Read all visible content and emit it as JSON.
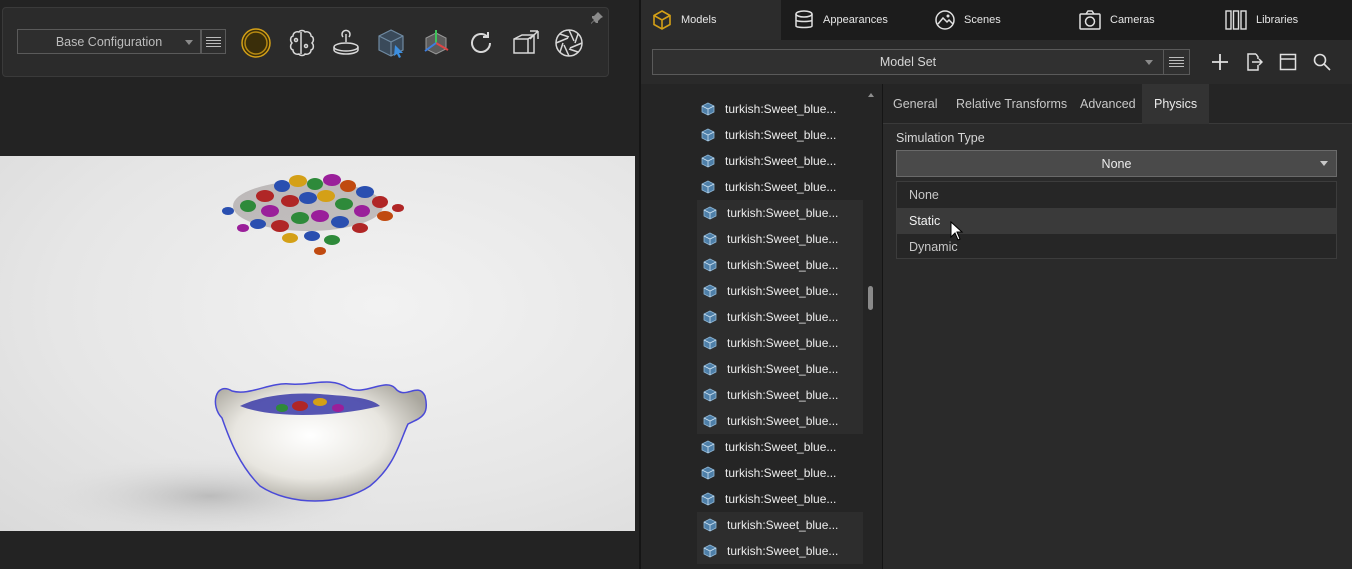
{
  "toolbar": {
    "config_select": "Base Configuration",
    "tools": [
      "environment-sphere-icon",
      "neural-render-icon",
      "turntable-icon",
      "model-select-cube-icon",
      "transform-gizmo-icon",
      "refresh-icon",
      "pivot-cube-icon",
      "camera-aperture-icon"
    ]
  },
  "tabs": [
    {
      "label": "Models",
      "icon": "cube-icon",
      "active": true
    },
    {
      "label": "Appearances",
      "icon": "database-icon",
      "active": false
    },
    {
      "label": "Scenes",
      "icon": "image-icon",
      "active": false
    },
    {
      "label": "Cameras",
      "icon": "camera-icon",
      "active": false
    },
    {
      "label": "Libraries",
      "icon": "books-icon",
      "active": false
    }
  ],
  "model_toolbar": {
    "select_value": "Model Set",
    "actions": [
      "add-icon",
      "export-icon",
      "layout-icon",
      "search-icon"
    ]
  },
  "tree": {
    "items": [
      {
        "label": "turkish:Sweet_blue..."
      },
      {
        "label": "turkish:Sweet_blue..."
      },
      {
        "label": "turkish:Sweet_blue..."
      },
      {
        "label": "turkish:Sweet_blue..."
      },
      {
        "label": "turkish:Sweet_blue..."
      },
      {
        "label": "turkish:Sweet_blue..."
      },
      {
        "label": "turkish:Sweet_blue..."
      },
      {
        "label": "turkish:Sweet_blue..."
      },
      {
        "label": "turkish:Sweet_blue..."
      },
      {
        "label": "turkish:Sweet_blue..."
      },
      {
        "label": "turkish:Sweet_blue..."
      },
      {
        "label": "turkish:Sweet_blue..."
      },
      {
        "label": "turkish:Sweet_blue..."
      },
      {
        "label": "turkish:Sweet_blue..."
      },
      {
        "label": "turkish:Sweet_blue..."
      },
      {
        "label": "turkish:Sweet_blue..."
      },
      {
        "label": "turkish:Sweet_blue..."
      },
      {
        "label": "turkish:Sweet_blue..."
      }
    ]
  },
  "properties": {
    "tabs": [
      "General",
      "Relative Transforms",
      "Advanced",
      "Physics"
    ],
    "active_tab": "Physics",
    "simulation_type_label": "Simulation Type",
    "simulation_type_value": "None",
    "simulation_options": [
      "None",
      "Static",
      "Dynamic"
    ],
    "hovered_option": "Static"
  },
  "colors": {
    "accent_gold": "#d4a017",
    "panel_bg": "#2a2a2a",
    "tab_bar_bg": "#1c1c1c"
  }
}
